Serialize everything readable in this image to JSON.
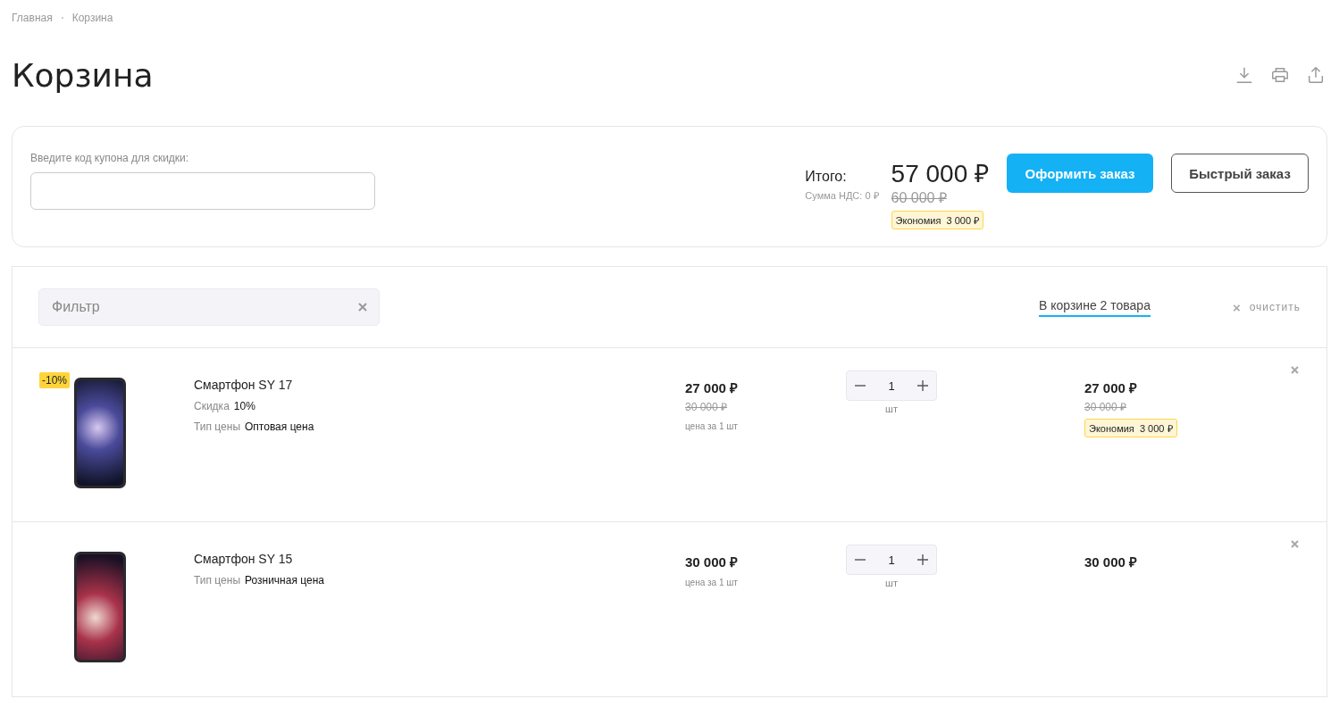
{
  "breadcrumbs": [
    "Главная",
    "Корзина"
  ],
  "title": "Корзина",
  "coupon": {
    "label": "Введите код купона для скидки:"
  },
  "summary": {
    "total_label": "Итого:",
    "vat": "Сумма НДС: 0 ₽",
    "total": "57 000 ₽",
    "old_total": "60 000 ₽",
    "savings": "Экономия  3 000 ₽"
  },
  "buttons": {
    "checkout": "Оформить заказ",
    "quick": "Быстрый заказ"
  },
  "filter": {
    "placeholder": "Фильтр"
  },
  "tabs": [
    {
      "label": "В корзине 2 товара",
      "selected": true
    }
  ],
  "clear": {
    "icon": "×",
    "label": "очистить"
  },
  "items": [
    {
      "badge": "-10%",
      "name": "Смартфон SY 17",
      "props": [
        {
          "label": "Скидка",
          "value": "10%"
        },
        {
          "label": "Тип цены",
          "value": "Оптовая цена"
        }
      ],
      "price": "27 000 ₽",
      "old_price": "30 000 ₽",
      "unit_note": "цена за 1 шт",
      "qty": "1",
      "unit": "шт",
      "total": "27 000 ₽",
      "old_total": "30 000 ₽",
      "savings": "Экономия  3 000 ₽"
    },
    {
      "name": "Смартфон SY 15",
      "props": [
        {
          "label": "Тип цены",
          "value": "Розничная цена"
        }
      ],
      "price": "30 000 ₽",
      "unit_note": "цена за 1 шт",
      "qty": "1",
      "unit": "шт",
      "total": "30 000 ₽"
    }
  ]
}
